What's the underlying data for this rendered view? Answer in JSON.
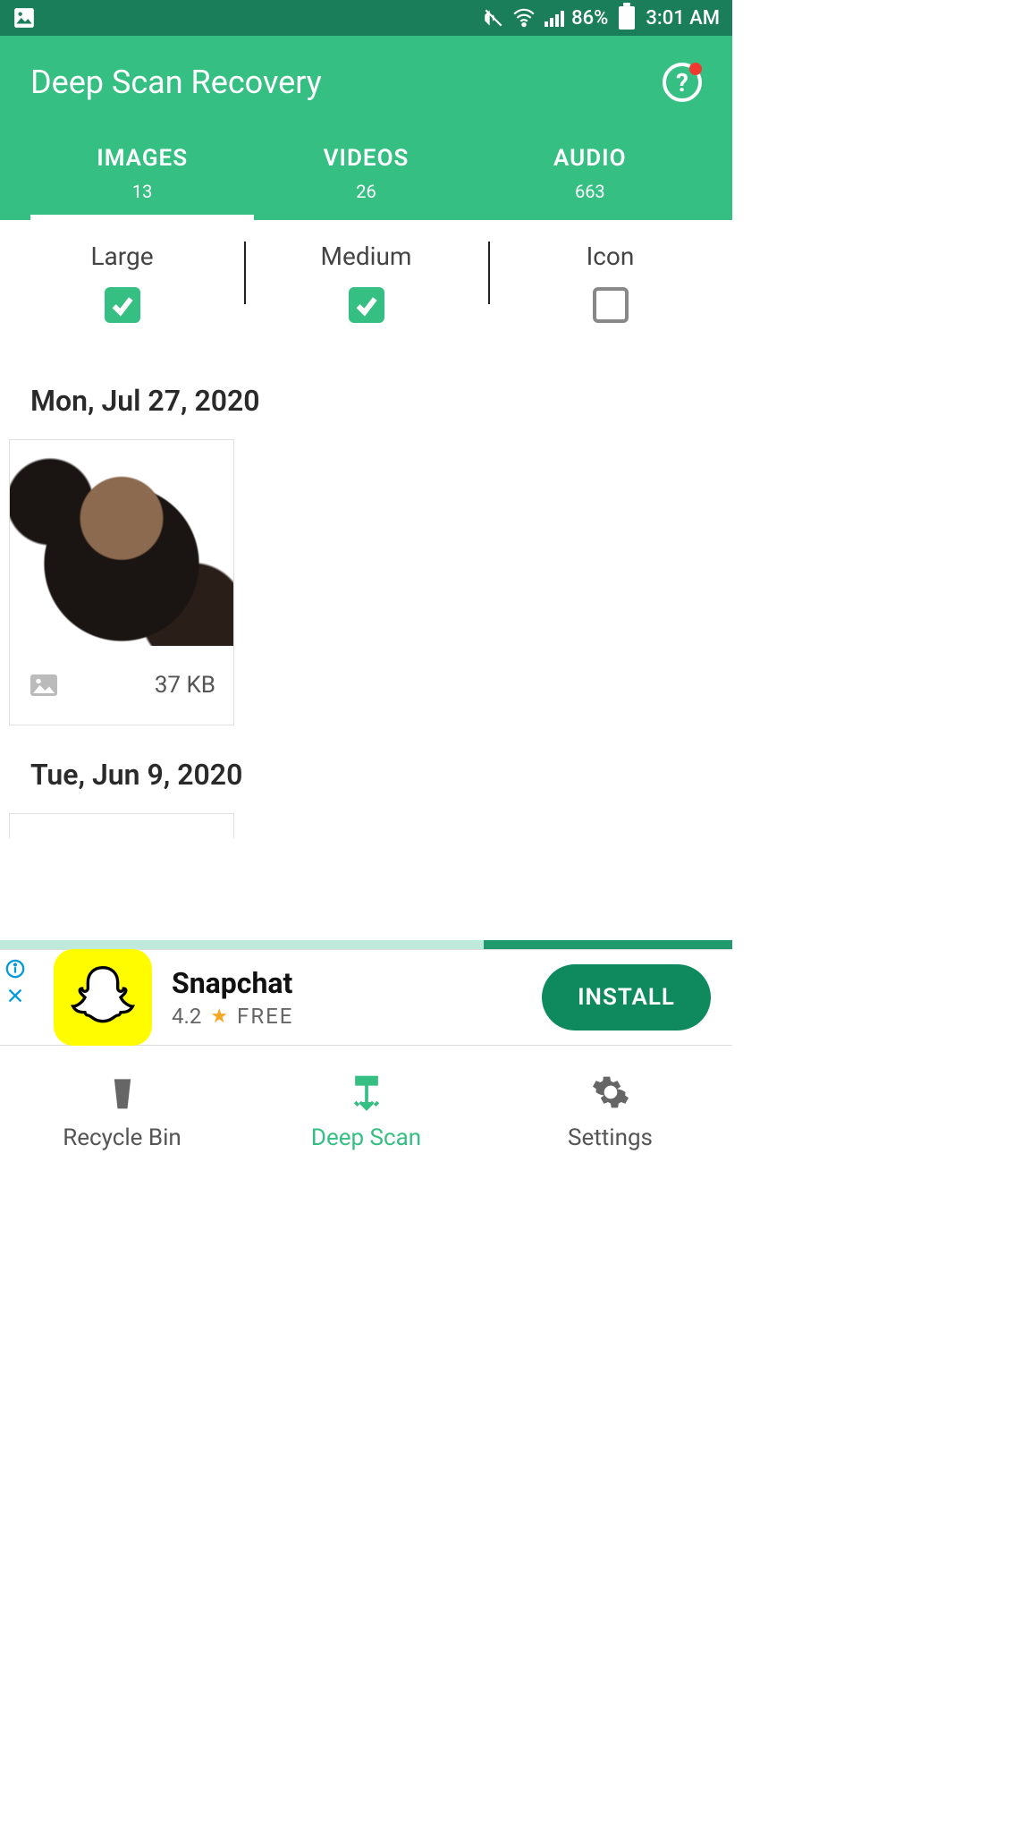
{
  "status": {
    "battery_pct": "86%",
    "time": "3:01 AM"
  },
  "header": {
    "title": "Deep Scan Recovery"
  },
  "tabs": [
    {
      "label": "IMAGES",
      "count": "13",
      "active": true
    },
    {
      "label": "VIDEOS",
      "count": "26",
      "active": false
    },
    {
      "label": "AUDIO",
      "count": "663",
      "active": false
    }
  ],
  "size_filters": [
    {
      "label": "Large",
      "checked": true
    },
    {
      "label": "Medium",
      "checked": true
    },
    {
      "label": "Icon",
      "checked": false
    }
  ],
  "groups": [
    {
      "date": "Mon, Jul 27, 2020",
      "items": [
        {
          "size": "37 KB"
        }
      ]
    },
    {
      "date": "Tue, Jun 9, 2020",
      "items": [
        {}
      ]
    }
  ],
  "ad": {
    "name": "Snapchat",
    "rating": "4.2",
    "price": "FREE",
    "cta": "INSTALL"
  },
  "bottom_nav": [
    {
      "label": "Recycle Bin",
      "active": false
    },
    {
      "label": "Deep Scan",
      "active": true
    },
    {
      "label": "Settings",
      "active": false
    }
  ]
}
